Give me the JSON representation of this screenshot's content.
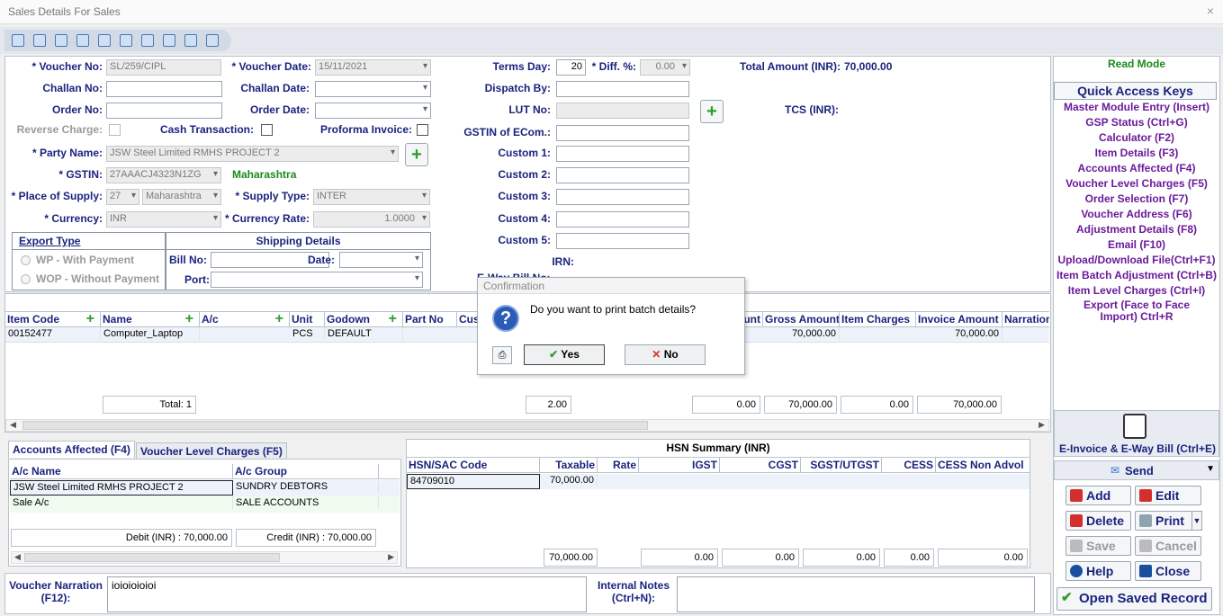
{
  "window": {
    "title": "Sales Details For Sales",
    "close": "×"
  },
  "toolbar": {
    "icons": [
      "save-icon",
      "money-icon",
      "currency-icon",
      "document-icon",
      "basket-icon",
      "basket-alt-icon",
      "pen-icon",
      "pen-alt-icon",
      "magnifier-icon",
      "magnifier-alt-icon"
    ]
  },
  "form": {
    "voucher_no_label": "* Voucher No:",
    "voucher_no": "SL/259/CIPL",
    "voucher_date_label": "* Voucher Date:",
    "voucher_date": "15/11/2021",
    "challan_no_label": "Challan No:",
    "challan_no": "",
    "challan_date_label": "Challan Date:",
    "challan_date": "",
    "order_no_label": "Order No:",
    "order_no": "",
    "order_date_label": "Order Date:",
    "order_date": "",
    "reverse_charge_label": "Reverse Charge:",
    "cash_transaction_label": "Cash Transaction:",
    "proforma_invoice_label": "Proforma Invoice:",
    "party_name_label": "* Party Name:",
    "party_name": "JSW Steel Limited RMHS PROJECT 2",
    "gstin_label": "* GSTIN:",
    "gstin": "27AAACJ4323N1ZG",
    "state": "Maharashtra",
    "place_of_supply_label": "* Place of Supply:",
    "place_code": "27",
    "place_name": "Maharashtra",
    "supply_type_label": "* Supply Type:",
    "supply_type": "INTER",
    "currency_label": "* Currency:",
    "currency": "INR",
    "currency_rate_label": "* Currency Rate:",
    "currency_rate": "1.0000",
    "terms_day_label": "Terms Day:",
    "terms_day": "20",
    "diff_label": "* Diff. %:",
    "diff": "0.00",
    "dispatch_by_label": "Dispatch By:",
    "dispatch_by": "",
    "lut_no_label": "LUT No:",
    "gstin_ecom_label": "GSTIN of ECom.:",
    "custom1_label": "Custom 1:",
    "custom2_label": "Custom 2:",
    "custom3_label": "Custom 3:",
    "custom4_label": "Custom 4:",
    "custom5_label": "Custom 5:",
    "irn_label": "IRN:",
    "eway_label": "E-Way Bill No:",
    "total_amount_label": "Total Amount (INR):",
    "total_amount": "70,000.00",
    "tcs_label": "TCS (INR):"
  },
  "export": {
    "title": "Export Type",
    "wp": "WP - With Payment",
    "wop": "WOP - Without Payment"
  },
  "shipping": {
    "title": "Shipping Details",
    "bill_no_label": "Bill No:",
    "date_label": "Date:",
    "port_label": "Port:"
  },
  "items": {
    "headers": [
      "Item Code",
      "Name",
      "A/c",
      "Unit",
      "Godown",
      "Part No",
      "Cus",
      "unt",
      "Gross Amount",
      "Item Charges",
      "Invoice Amount",
      "Narration"
    ],
    "rows": [
      {
        "code": "00152477",
        "name": "Computer_Laptop",
        "ac": "",
        "unit": "PCS",
        "godown": "DEFAULT",
        "gross": "70,000.00",
        "invoice": "70,000.00"
      }
    ],
    "total_label": "Total: 1",
    "total_qty": "2.00",
    "total_col1": "0.00",
    "total_gross": "70,000.00",
    "total_charges": "0.00",
    "total_invoice": "70,000.00"
  },
  "tabs": {
    "accounts": "Accounts Affected (F4)",
    "voucher_charges": "Voucher Level Charges (F5)"
  },
  "accounts": {
    "headers": [
      "A/c Name",
      "A/c Group"
    ],
    "rows": [
      [
        "JSW Steel Limited RMHS PROJECT 2",
        "SUNDRY DEBTORS"
      ],
      [
        "Sale A/c",
        "SALE ACCOUNTS"
      ]
    ],
    "debit": "Debit (INR) : 70,000.00",
    "credit": "Credit (INR) : 70,000.00"
  },
  "hsn": {
    "title": "HSN Summary (INR)",
    "headers": [
      "HSN/SAC Code",
      "Taxable",
      "Rate",
      "IGST",
      "CGST",
      "SGST/UTGST",
      "CESS",
      "CESS Non Advol"
    ],
    "row": {
      "code": "84709010",
      "taxable": "70,000.00"
    },
    "totals": [
      "70,000.00",
      "0.00",
      "0.00",
      "0.00",
      "0.00",
      "0.00"
    ]
  },
  "narration": {
    "label": "Voucher Narration (F12):",
    "value": "ioioioioioi",
    "notes_label": "Internal Notes (Ctrl+N):"
  },
  "side": {
    "mode": "Read Mode",
    "qak_title": "Quick Access Keys",
    "keys": [
      "Master Module Entry (Insert)",
      "GSP Status (Ctrl+G)",
      "Calculator (F2)",
      "Item Details (F3)",
      "Accounts Affected (F4)",
      "Voucher Level Charges (F5)",
      "Order Selection (F7)",
      "Voucher Address (F6)",
      "Adjustment Details (F8)",
      "Email (F10)",
      "Upload/Download File(Ctrl+F1)",
      "Item Batch Adjustment (Ctrl+B)",
      "Item Level Charges (Ctrl+I)",
      "Export (Face to Face Import) Ctrl+R"
    ],
    "einvoice": "E-Invoice & E-Way Bill (Ctrl+E)",
    "send": "Send",
    "add": "Add",
    "edit": "Edit",
    "delete": "Delete",
    "print": "Print",
    "save": "Save",
    "cancel": "Cancel",
    "help": "Help",
    "close": "Close",
    "open_saved": "Open Saved Record"
  },
  "dialog": {
    "title": "Confirmation",
    "message": "Do you want to print batch details?",
    "yes": "Yes",
    "no": "No"
  }
}
